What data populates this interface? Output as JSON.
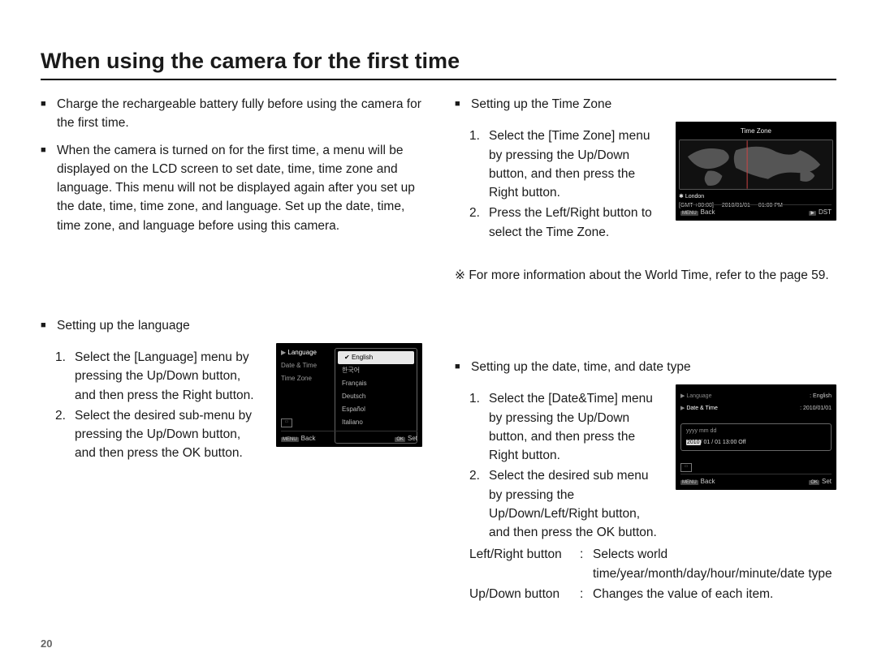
{
  "title": "When using the camera for the first time",
  "page_number": "20",
  "left": {
    "bullet1": "Charge the rechargeable battery fully before using the camera for the first time.",
    "bullet2": "When the camera is turned on for the first time, a menu will be displayed on the LCD screen to set date, time, time zone and language. This menu will not be displayed again after you set up the date, time, time zone, and language. Set up the date, time, time zone, and language before using this camera.",
    "lang_heading": "Setting up the language",
    "lang_step1": "Select the [Language] menu by pressing the Up/Down button, and then press the Right button.",
    "lang_step2": "Select the desired sub-menu by pressing the Up/Down button, and then press the OK button."
  },
  "right": {
    "tz_heading": "Setting up the Time Zone",
    "tz_step1": "Select the [Time Zone] menu by pressing the Up/Down button, and then press the Right button.",
    "tz_step2": "Press the Left/Right button to select the Time Zone.",
    "tz_ref_symbol": "※",
    "tz_ref": "For more information about the World Time, refer to the page 59.",
    "dt_heading": "Setting up the date, time, and date type",
    "dt_step1": "Select the [Date&Time] menu by pressing the Up/Down button, and then press the Right button.",
    "dt_step2": "Select the desired sub menu by pressing the Up/Down/Left/Right button, and then press the OK button.",
    "lr_label": "Left/Right button",
    "lr_desc": "Selects world time/year/month/day/hour/minute/date type",
    "ud_label": "Up/Down button",
    "ud_desc": "Changes the value of each item."
  },
  "square": "■",
  "colon": ":",
  "steps": {
    "n1": "1.",
    "n2": "2."
  },
  "lcd_lang": {
    "menu": [
      "Language",
      "Date & Time",
      "Time Zone"
    ],
    "options": [
      "English",
      "한국어",
      "Français",
      "Deutsch",
      "Español",
      "Italiano"
    ],
    "back_btn": "MENU",
    "back": "Back",
    "ok_btn": "OK",
    "ok": "Set"
  },
  "lcd_tz": {
    "title": "Time Zone",
    "city": "London",
    "gmt": "[GMT +00:00]",
    "date": "2010/01/01",
    "time": "01:00 PM",
    "back_btn": "MENU",
    "back": "Back",
    "dst_btn": "▶",
    "dst": "DST",
    "star": "✱"
  },
  "lcd_dt": {
    "menu1": "Language",
    "menu1_val": "English",
    "menu2": "Date & Time",
    "menu2_val": "2010/01/01",
    "fmt": "yyyy mm dd",
    "year_hl": "2010",
    "rest": "/ 01 / 01   13:00   Off",
    "back_btn": "MENU",
    "back": "Back",
    "ok_btn": "OK",
    "ok": "Set"
  }
}
